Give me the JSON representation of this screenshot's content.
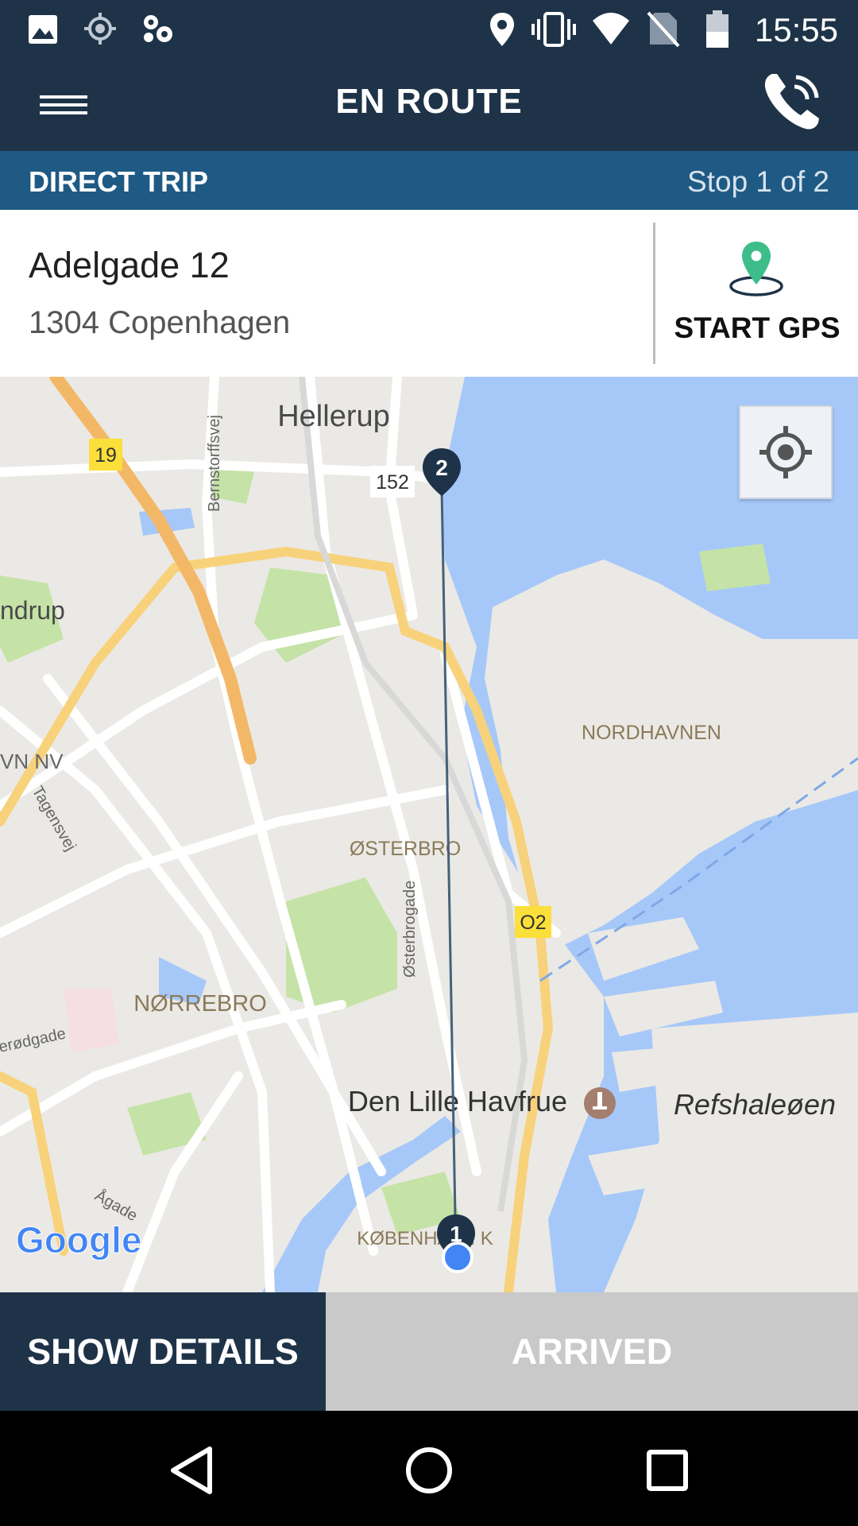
{
  "status_bar": {
    "time": "15:55",
    "left_icons": [
      "image-icon",
      "gps-fix-icon",
      "app-gear-icon"
    ],
    "right_icons": [
      "location-pin-icon",
      "vibrate-icon",
      "wifi-icon",
      "no-sim-icon",
      "battery-icon"
    ]
  },
  "app_bar": {
    "title": "EN ROUTE",
    "menu_icon": "hamburger-menu-icon",
    "call_icon": "phone-call-icon"
  },
  "trip": {
    "type": "DIRECT TRIP",
    "stop": "Stop 1 of 2"
  },
  "address": {
    "line1": "Adelgade 12",
    "line2": "1304 Copenhagen"
  },
  "gps": {
    "label": "START GPS",
    "icon": "map-pin-icon",
    "pin_color": "#3dbd8a"
  },
  "map": {
    "labels": {
      "hellerup": "Hellerup",
      "nordhavnen": "NORDHAVNEN",
      "osterbro": "ØSTERBRO",
      "norrebro": "NØRREBRO",
      "lille_havfrue": "Den Lille Havfrue",
      "refshaleoen": "Refshaleøen",
      "kobenhavn": "KØBENHAVN K",
      "bernstorffsvej": "Bernstorffsvej",
      "tagensvej": "Tagensvej",
      "osterbrogade": "Østerbrogade",
      "ndrup": "ndrup",
      "vn_nv": "VN NV",
      "erodgade": "erødgade",
      "agade": "Ågade",
      "road_19": "19",
      "road_o2": "O2",
      "road_152": "152"
    },
    "markers": {
      "stop_1": "1",
      "stop_2": "2"
    },
    "logo": "Google",
    "colors": {
      "water": "#a6c8f9",
      "park": "#c5e3a7",
      "highway": "#f3b867",
      "route": "#45617a",
      "marker": "#1e3348",
      "current_location": "#4285f4"
    }
  },
  "buttons": {
    "show_details": "SHOW DETAILS",
    "arrived": "ARRIVED"
  },
  "nav_bar": {
    "back_icon": "back-triangle-icon",
    "home_icon": "home-circle-icon",
    "recents_icon": "recents-square-icon"
  }
}
